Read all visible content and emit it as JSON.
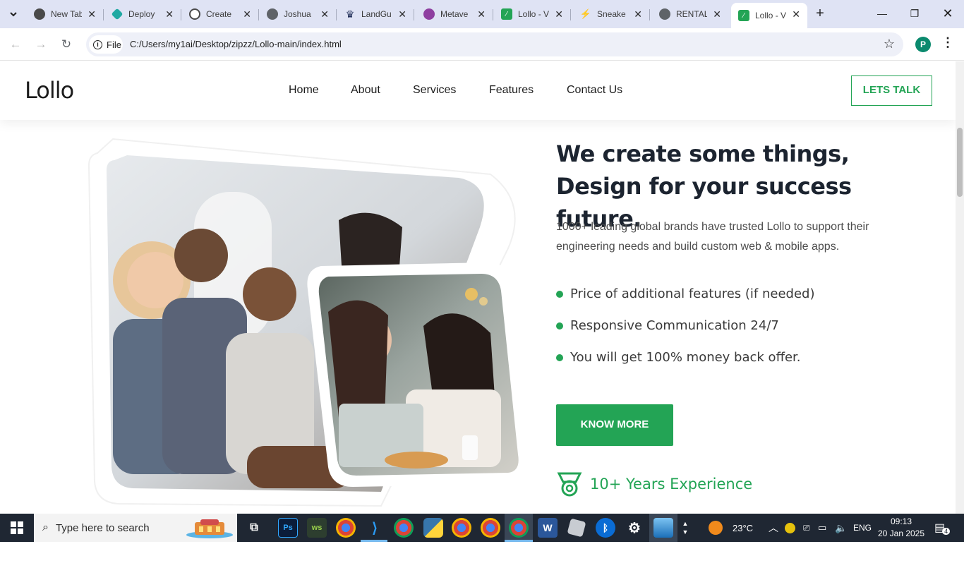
{
  "browser": {
    "tabs": [
      {
        "title": "New Tab",
        "icon": "chrome-icon",
        "color": "#4a4a4a"
      },
      {
        "title": "Deploy",
        "icon": "netlify-icon",
        "color": "#20a9a3"
      },
      {
        "title": "Create",
        "icon": "openai-icon",
        "color": "#4a4a4a"
      },
      {
        "title": "Joshua",
        "icon": "globe-icon",
        "color": "#4a4a4a"
      },
      {
        "title": "LandGu",
        "icon": "crown-icon",
        "color": "#1d2b55"
      },
      {
        "title": "Metave",
        "icon": "circle-icon",
        "color": "#8e3fa0"
      },
      {
        "title": "Lollo - V",
        "icon": "lollo-icon",
        "color": "#23a455"
      },
      {
        "title": "Sneake",
        "icon": "sneaker-icon",
        "color": "#333333"
      },
      {
        "title": "RENTAL",
        "icon": "globe-icon",
        "color": "#4a4a4a"
      },
      {
        "title": "Lollo - V",
        "icon": "lollo-icon",
        "color": "#23a455",
        "active": true
      }
    ],
    "address": {
      "chip_label": "File",
      "url": "C:/Users/my1ai/Desktop/zipzz/Lollo-main/index.html"
    },
    "profile_initial": "P"
  },
  "site": {
    "logo": "Lollo",
    "nav": [
      "Home",
      "About",
      "Services",
      "Features",
      "Contact Us"
    ],
    "cta": "LETS TALK",
    "headline": "We create some things, Design for your success future.",
    "intro": "1000+ leading global brands have trusted Lollo to support their engineering needs and build custom web & mobile apps.",
    "features": [
      "Price of additional features (if needed)",
      "Responsive Communication 24/7",
      "You will get 100% money back offer."
    ],
    "button": "KNOW MORE",
    "experience": "10+ Years Experience",
    "accent": "#23a455"
  },
  "taskbar": {
    "search_placeholder": "Type here to search",
    "weather": "23°C",
    "language": "ENG",
    "time": "09:13",
    "date": "20 Jan 2025",
    "notifications": "4"
  }
}
